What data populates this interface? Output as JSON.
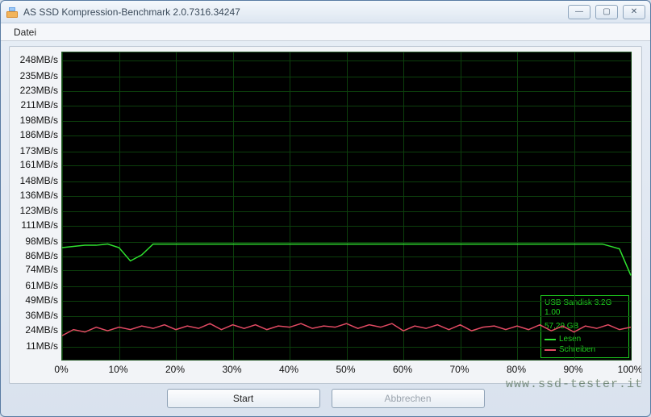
{
  "window": {
    "title": "AS SSD Kompression-Benchmark 2.0.7316.34247",
    "icon": "app-icon"
  },
  "menu": {
    "datei": "Datei"
  },
  "buttons": {
    "start": "Start",
    "abort": "Abbrechen"
  },
  "watermark": "www.ssd-tester.it",
  "window_controls": {
    "min": "—",
    "max": "▢",
    "close": "✕"
  },
  "legend": {
    "device_line1": "USB  Sandisk 3.2G",
    "device_line2": "1.00",
    "capacity": "57,29 GB",
    "read_label": "Lesen",
    "write_label": "Schreiben",
    "read_color": "#2fe22f",
    "write_color": "#e24a63"
  },
  "chart_data": {
    "type": "line",
    "title": "",
    "xlabel": "",
    "ylabel": "",
    "x_unit": "%",
    "y_unit": "MB/s",
    "xlim": [
      0,
      100
    ],
    "ylim": [
      0,
      255
    ],
    "x_ticks": [
      0,
      10,
      20,
      30,
      40,
      50,
      60,
      70,
      80,
      90,
      100
    ],
    "y_ticks": [
      11,
      24,
      36,
      49,
      61,
      74,
      86,
      98,
      111,
      123,
      136,
      148,
      161,
      173,
      186,
      198,
      211,
      223,
      235,
      248
    ],
    "series": [
      {
        "name": "Lesen",
        "color": "#2fe22f",
        "x": [
          0,
          2,
          4,
          6,
          8,
          10,
          12,
          14,
          16,
          18,
          20,
          25,
          30,
          35,
          40,
          45,
          50,
          55,
          60,
          65,
          70,
          75,
          80,
          85,
          90,
          95,
          98,
          100
        ],
        "values": [
          93,
          94,
          95,
          95,
          96,
          93,
          82,
          87,
          96,
          96,
          96,
          96,
          96,
          96,
          96,
          96,
          96,
          96,
          96,
          96,
          96,
          96,
          96,
          96,
          96,
          96,
          92,
          70
        ]
      },
      {
        "name": "Schreiben",
        "color": "#e24a63",
        "x": [
          0,
          2,
          4,
          6,
          8,
          10,
          12,
          14,
          16,
          18,
          20,
          22,
          24,
          26,
          28,
          30,
          32,
          34,
          36,
          38,
          40,
          42,
          44,
          46,
          48,
          50,
          52,
          54,
          56,
          58,
          60,
          62,
          64,
          66,
          68,
          70,
          72,
          74,
          76,
          78,
          80,
          82,
          84,
          86,
          88,
          90,
          92,
          94,
          96,
          98,
          100
        ],
        "values": [
          20,
          25,
          23,
          27,
          24,
          27,
          25,
          28,
          26,
          29,
          25,
          28,
          26,
          30,
          25,
          29,
          26,
          29,
          25,
          28,
          27,
          30,
          26,
          28,
          27,
          30,
          26,
          29,
          27,
          30,
          24,
          28,
          26,
          29,
          25,
          29,
          24,
          27,
          28,
          25,
          28,
          25,
          29,
          24,
          28,
          23,
          28,
          26,
          29,
          25,
          27
        ]
      }
    ]
  }
}
